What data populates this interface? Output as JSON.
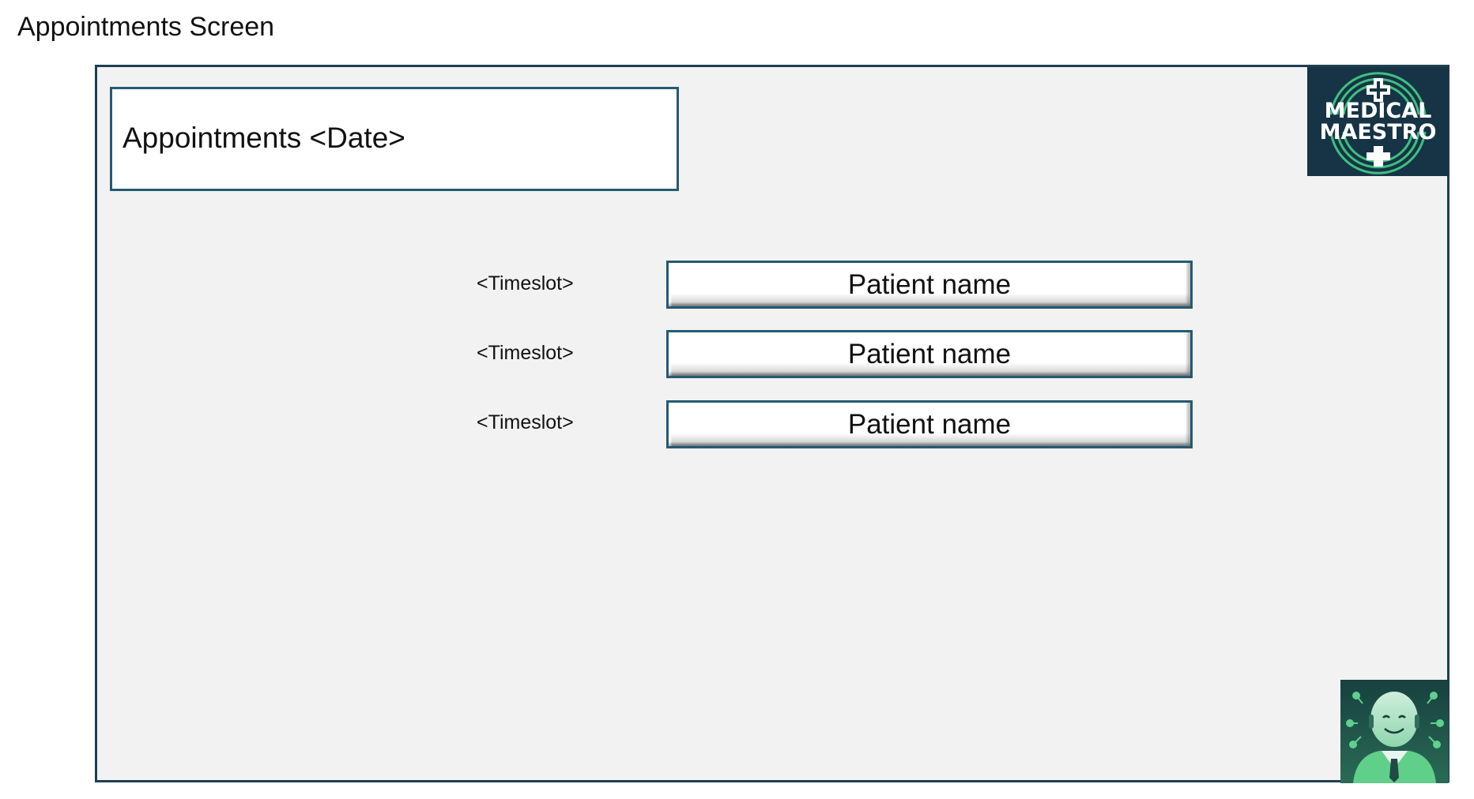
{
  "screen_caption": "Appointments Screen",
  "header": {
    "title": "Appointments <Date>"
  },
  "logo": {
    "line1": "MEDICAL",
    "line2": "MAESTRO",
    "icon": "medical-cross-logo"
  },
  "appointments": [
    {
      "timeslot": "<Timeslot>",
      "patient": "Patient name"
    },
    {
      "timeslot": "<Timeslot>",
      "patient": "Patient name"
    },
    {
      "timeslot": "<Timeslot>",
      "patient": "Patient name"
    }
  ],
  "assistant": {
    "icon": "doctor-assistant-avatar"
  },
  "colors": {
    "frame_border": "#1d3f50",
    "frame_bg": "#f2f2f2",
    "logo_bg": "#163445",
    "accent_green": "#3fbf7f"
  }
}
